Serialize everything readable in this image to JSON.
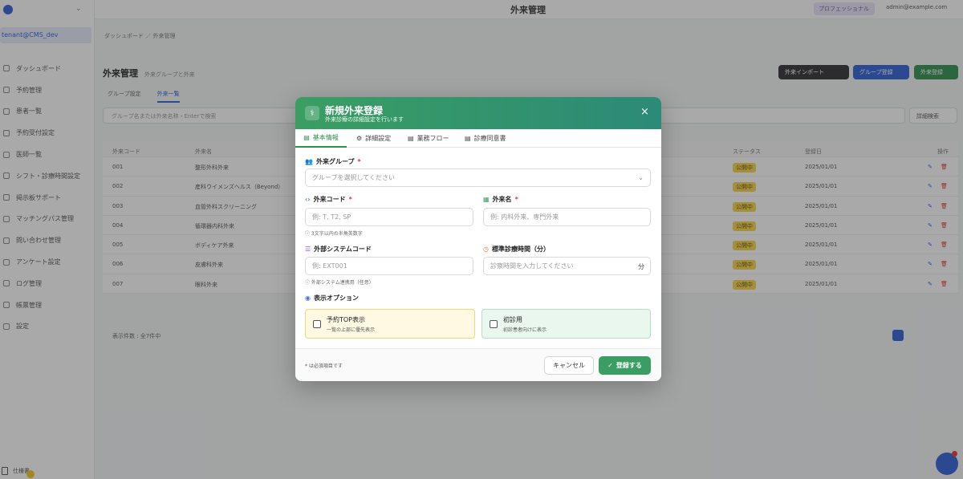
{
  "background": {
    "sidebar": {
      "user": "tenant@CMS_dev",
      "items": [
        "ダッシュボード",
        "予約管理",
        "患者一覧",
        "予約受付設定",
        "医師一覧",
        "シフト・診療時間設定",
        "掲示板サポート",
        "マッチングパス管理",
        "問い合わせ管理",
        "アンケート設定",
        "ログ管理",
        "帳票管理",
        "設定"
      ],
      "footer": "仕様書"
    },
    "topbar": {
      "title": "外来管理",
      "plan": "プロフェッショナル",
      "email": "admin@example.com"
    },
    "breadcrumb": "ダッシュボード ／ 外来管理",
    "page_title": "外来管理",
    "page_subtitle": "外来グループと外来",
    "buttons": {
      "dark": "外来インポート",
      "blue": "グループ登録",
      "green": "外来登録"
    },
    "tabs": [
      "グループ設定",
      "外来一覧"
    ],
    "search_placeholder": "グループ名または外来名称・Enterで検索",
    "filter": "詳細検索",
    "table": {
      "headers": [
        "外来コード",
        "外来名",
        "ステータス",
        "登録日",
        "操作"
      ],
      "rows": [
        [
          "001",
          "整形外科外来",
          "公開中",
          "2025/01/01"
        ],
        [
          "002",
          "産科ウイメンズヘルス（Beyond）",
          "公開中",
          "2025/01/01"
        ],
        [
          "003",
          "血管外科スクリーニング",
          "公開中",
          "2025/01/01"
        ],
        [
          "004",
          "循環器内科外来",
          "公開中",
          "2025/01/01"
        ],
        [
          "005",
          "ボディケア外来",
          "公開中",
          "2025/01/01"
        ],
        [
          "006",
          "皮膚科外来",
          "公開中",
          "2025/01/01"
        ],
        [
          "007",
          "眼科外来",
          "公開中",
          "2025/01/01"
        ]
      ]
    },
    "pager": "表示件数 : 全7件中"
  },
  "modal": {
    "title": "新規外来登録",
    "subtitle": "外来診療の詳細設定を行います",
    "close": "×",
    "tabs": [
      {
        "label": "基本情報",
        "icon": "document-icon"
      },
      {
        "label": "詳細設定",
        "icon": "gear-icon"
      },
      {
        "label": "業務フロー",
        "icon": "document-icon"
      },
      {
        "label": "診療同意書",
        "icon": "document-icon"
      }
    ],
    "group": {
      "label": "外来グループ",
      "required": "*",
      "placeholder": "グループを選択してください"
    },
    "code": {
      "label": "外来コード",
      "required": "*",
      "placeholder": "例: T, T2, SP",
      "hint": "3文字以内の半角英数字"
    },
    "name": {
      "label": "外来名",
      "required": "*",
      "placeholder": "例: 内科外来、専門外来"
    },
    "system_code": {
      "label": "外部システムコード",
      "placeholder": "例: EXT001",
      "hint": "外部システム連携用（任意）"
    },
    "duration": {
      "label": "標準診療時間（分）",
      "placeholder": "診察時間を入力してください",
      "unit": "分"
    },
    "display": {
      "label": "表示オプション",
      "options": [
        {
          "title": "予約TOP表示",
          "subtitle": "一覧の上部に優先表示",
          "checked": false
        },
        {
          "title": "初診用",
          "subtitle": "初診患者向けに表示",
          "checked": false
        }
      ]
    },
    "footer_note": "* は必須項目です",
    "cancel": "キャンセル",
    "submit": "登録する"
  },
  "colors": {
    "accent": "#3a9e62",
    "accent_dark": "#2c8a77",
    "required": "#dd3333"
  }
}
